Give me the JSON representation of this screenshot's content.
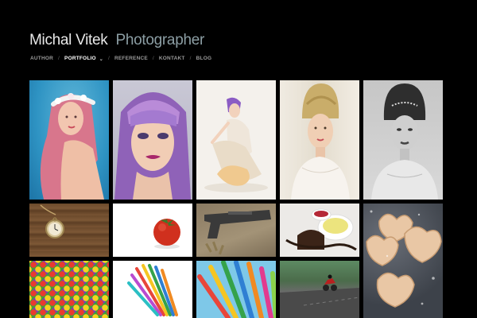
{
  "header": {
    "name": "Michal Vitek",
    "role": "Photographer"
  },
  "nav": {
    "items": [
      {
        "label": "AUTHOR"
      },
      {
        "label": "PORTFOLIO",
        "active": true
      },
      {
        "label": "REFERENCE"
      },
      {
        "label": "KONTAKT"
      },
      {
        "label": "BLOG"
      }
    ],
    "separator": "/"
  },
  "colors": {
    "background": "#000000",
    "name": "#e8e8e8",
    "role": "#8c9ea4",
    "nav": "#9a9a9a",
    "nav_active": "#ffffff"
  },
  "gallery": {
    "tiles": [
      "portrait-pink-hair-flower-crown",
      "portrait-purple-hair",
      "fashion-purple-hair-seated",
      "portrait-blonde-updo",
      "portrait-black-white-updo",
      "pocket-watch-on-wood",
      "tomato-white",
      "pistol-and-bullets",
      "chocolate-dessert-plate",
      "heart-cookies-sugar",
      "colorful-candies",
      "colorful-straws-bundle",
      "colorful-straws-closeup",
      "motorcycle-on-road"
    ]
  }
}
